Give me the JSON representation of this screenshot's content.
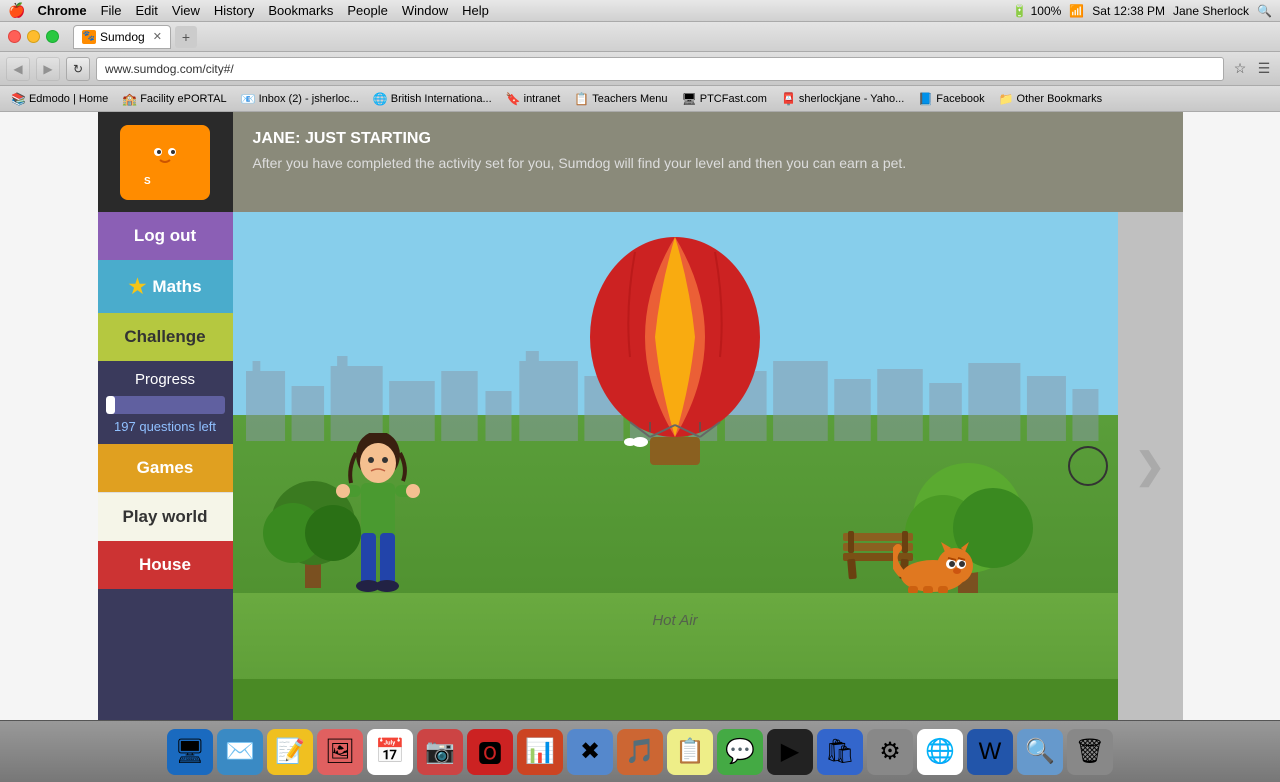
{
  "menubar": {
    "apple": "🍎",
    "items": [
      "Chrome",
      "File",
      "Edit",
      "View",
      "History",
      "Bookmarks",
      "People",
      "Window",
      "Help"
    ],
    "right_info": "Sat 12:38 PM",
    "user": "Jane Sherlock",
    "battery": "100%"
  },
  "browser": {
    "tab_title": "Sumdog",
    "url": "www.sumdog.com/city#/",
    "bookmarks": [
      {
        "label": "Edmodo | Home",
        "icon": "📚"
      },
      {
        "label": "Facility ePORTAL",
        "icon": "🏫"
      },
      {
        "label": "Inbox (2) - jsherloc...",
        "icon": "📧"
      },
      {
        "label": "British Internationa...",
        "icon": "🌐"
      },
      {
        "label": "intranet",
        "icon": "🔖"
      },
      {
        "label": "Teachers Menu",
        "icon": "📋"
      },
      {
        "label": "PTCFast.com",
        "icon": "🖥"
      },
      {
        "label": "sherlockjane - Yaho...",
        "icon": "📮"
      },
      {
        "label": "Facebook",
        "icon": "📘"
      },
      {
        "label": "Other Bookmarks",
        "icon": "📁"
      }
    ]
  },
  "header": {
    "title": "JANE: JUST STARTING",
    "description": "After you have completed the activity set for you, Sumdog will find your level and then you can earn a pet."
  },
  "sidebar": {
    "logout_label": "Log out",
    "maths_label": "Maths",
    "challenge_label": "Challenge",
    "progress_label": "Progress",
    "progress_questions": "197 questions left",
    "progress_percent": 8,
    "games_label": "Games",
    "play_world_label": "Play world",
    "house_label": "House"
  },
  "game": {
    "hot_air_label": "Hot Air"
  },
  "colors": {
    "logout_btn": "#8b5fb5",
    "maths_btn": "#4aaccc",
    "challenge_btn": "#b5c840",
    "games_btn": "#e0a020",
    "play_world_btn": "#f5f5e8",
    "house_btn": "#cc3333",
    "sidebar_bg": "#3a3a5c",
    "header_bg": "#8a8a7a"
  }
}
